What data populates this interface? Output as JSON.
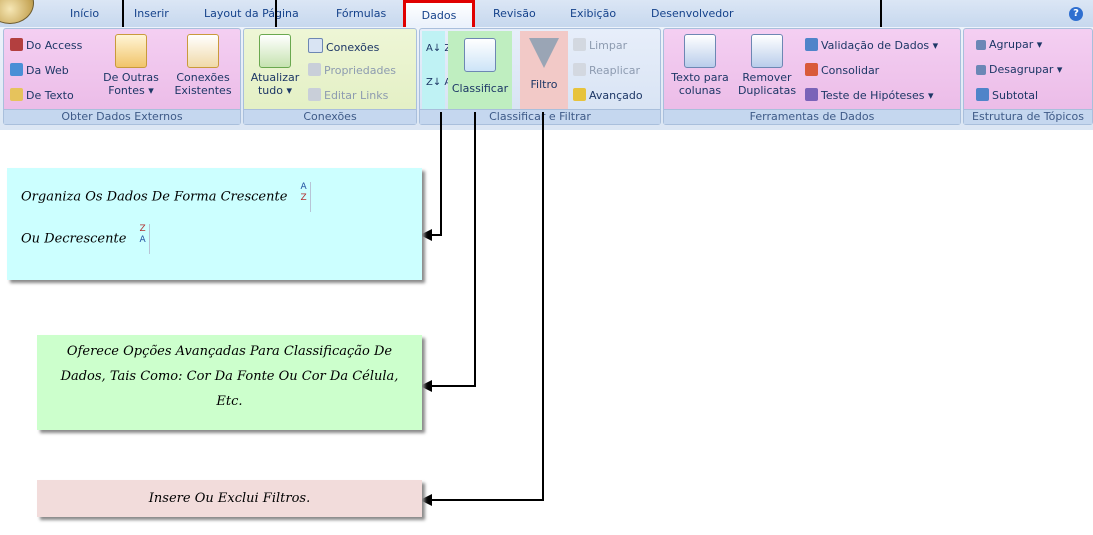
{
  "tabs": {
    "items": [
      "Início",
      "Inserir",
      "Layout da Página",
      "Fórmulas",
      "Dados",
      "Revisão",
      "Exibição",
      "Desenvolvedor"
    ],
    "active": "Dados"
  },
  "ribbon": {
    "obter": {
      "label": "Obter Dados Externos",
      "do_access": "Do Access",
      "da_web": "Da Web",
      "de_texto": "De Texto",
      "de_outras_1": "De Outras",
      "de_outras_2": "Fontes ▾",
      "conexoes_ex_1": "Conexões",
      "conexoes_ex_2": "Existentes"
    },
    "conexoes": {
      "label": "Conexões",
      "atualizar_1": "Atualizar",
      "atualizar_2": "tudo ▾",
      "conexoes": "Conexões",
      "propriedades": "Propriedades",
      "editar_links": "Editar Links"
    },
    "classificar": {
      "label": "Classificar e Filtrar",
      "az": "A↓ Z",
      "za": "Z↓ A",
      "classificar": "Classificar",
      "filtro": "Filtro",
      "limpar": "Limpar",
      "reaplicar": "Reaplicar",
      "avancado": "Avançado"
    },
    "ferramentas": {
      "label": "Ferramentas de Dados",
      "texto_1": "Texto para",
      "texto_2": "colunas",
      "remover_1": "Remover",
      "remover_2": "Duplicatas",
      "validacao": "Validação de Dados ▾",
      "consolidar": "Consolidar",
      "teste": "Teste de Hipóteses ▾"
    },
    "estrutura": {
      "label": "Estrutura de Tópicos",
      "agrupar": "Agrupar ▾",
      "desagrupar": "Desagrupar ▾",
      "subtotal": "Subtotal"
    }
  },
  "callouts": {
    "sort": {
      "line1": "Organiza Os Dados De Forma Crescente",
      "line2": "Ou Decrescente",
      "az_top": "A",
      "az_bottom": "Z",
      "za_top": "Z",
      "za_bottom": "A"
    },
    "classificar": {
      "line1": "Oferece Opções Avançadas Para Classificação De",
      "line2": "Dados, Tais Como: Cor Da Fonte Ou Cor Da Célula,",
      "line3": "Etc."
    },
    "filtro": {
      "text": "Insere Ou Exclui Filtros."
    }
  },
  "colors": {
    "ribbon_highlight_pink": "#f2c6ef",
    "callout_sort": "#ccffff",
    "callout_classificar": "#ccffcc",
    "callout_filtro": "#f2dcdb",
    "active_tab_border": "#e00000"
  }
}
